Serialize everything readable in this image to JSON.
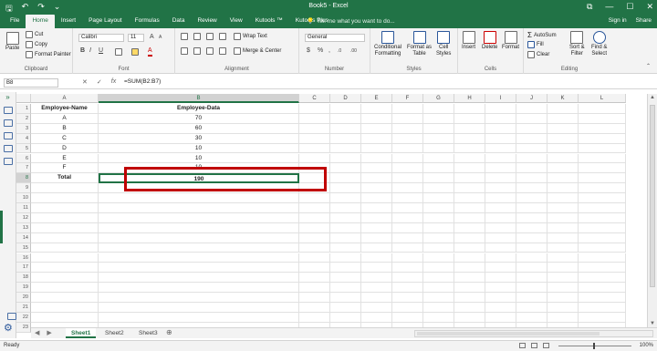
{
  "titlebar": {
    "title": "Book5 - Excel",
    "qat": {
      "save": "🖫",
      "undo": "↶",
      "redo": "↷",
      "customize": "⌄"
    },
    "window": {
      "ribbon_opts": "⧉",
      "minimize": "—",
      "maximize": "☐",
      "close": "✕"
    }
  },
  "menu": {
    "tabs": [
      "File",
      "Home",
      "Insert",
      "Page Layout",
      "Formulas",
      "Data",
      "Review",
      "View",
      "Kutools ™",
      "Kutools Plus"
    ],
    "active_tab": "Home",
    "tellme": "Tell me what you want to do...",
    "signin": "Sign in",
    "share": "Share"
  },
  "ribbon": {
    "clipboard": {
      "paste": "Paste",
      "cut": "Cut",
      "copy": "Copy",
      "format_painter": "Format Painter",
      "label": "Clipboard"
    },
    "font": {
      "name": "Calibri",
      "size": "11",
      "label": "Font",
      "bold": "B",
      "italic": "I",
      "underline": "U",
      "grow": "A",
      "shrink": "A",
      "font_color": "A"
    },
    "alignment": {
      "wrap": "Wrap Text",
      "merge": "Merge & Center",
      "label": "Alignment"
    },
    "number": {
      "format": "General",
      "currency": "$",
      "percent": "%",
      "comma": ",",
      "inc_dec": ".0",
      "dec_dec": ".00",
      "label": "Number"
    },
    "styles": {
      "conditional": "Conditional",
      "conditional2": "Formatting",
      "format_table": "Format as",
      "format_table2": "Table",
      "cell_styles": "Cell",
      "cell_styles2": "Styles",
      "label": "Styles"
    },
    "cells": {
      "insert": "Insert",
      "delete": "Delete",
      "format": "Format",
      "label": "Cells"
    },
    "editing": {
      "autosum": "AutoSum",
      "fill": "Fill",
      "clear": "Clear",
      "sort": "Sort &",
      "sort2": "Filter",
      "find": "Find &",
      "find2": "Select",
      "label": "Editing"
    }
  },
  "formula_bar": {
    "name_box": "B8",
    "cancel": "✕",
    "enter": "✓",
    "fx": "fx",
    "formula": "=SUM(B2:B7)"
  },
  "columns": [
    "A",
    "B",
    "C",
    "D",
    "E",
    "F",
    "G",
    "H",
    "I",
    "J",
    "K",
    "L"
  ],
  "rows": [
    "1",
    "2",
    "3",
    "4",
    "5",
    "6",
    "7",
    "8",
    "9",
    "10",
    "11",
    "12",
    "13",
    "14",
    "15",
    "16",
    "17",
    "18",
    "19",
    "20",
    "21",
    "22",
    "23"
  ],
  "sheet_data": {
    "A1": "Employee-Name",
    "B1": "Employee-Data",
    "A2": "A",
    "B2": "70",
    "A3": "B",
    "B3": "60",
    "A4": "C",
    "B4": "30",
    "A5": "D",
    "B5": "10",
    "A6": "E",
    "B6": "10",
    "A7": "F",
    "B7": "10",
    "A8": "Total",
    "B8": "190"
  },
  "active_cell": "B8",
  "sheets": [
    "Sheet1",
    "Sheet2",
    "Sheet3"
  ],
  "active_sheet": "Sheet1",
  "sheet_nav": {
    "prev": "◀",
    "next": "▶",
    "add": "⊕"
  },
  "status": {
    "ready": "Ready",
    "zoom": "100%"
  },
  "sidepanel": {
    "expand": "»"
  },
  "colors": {
    "excel_green": "#217346",
    "highlight_red": "#c00000"
  }
}
